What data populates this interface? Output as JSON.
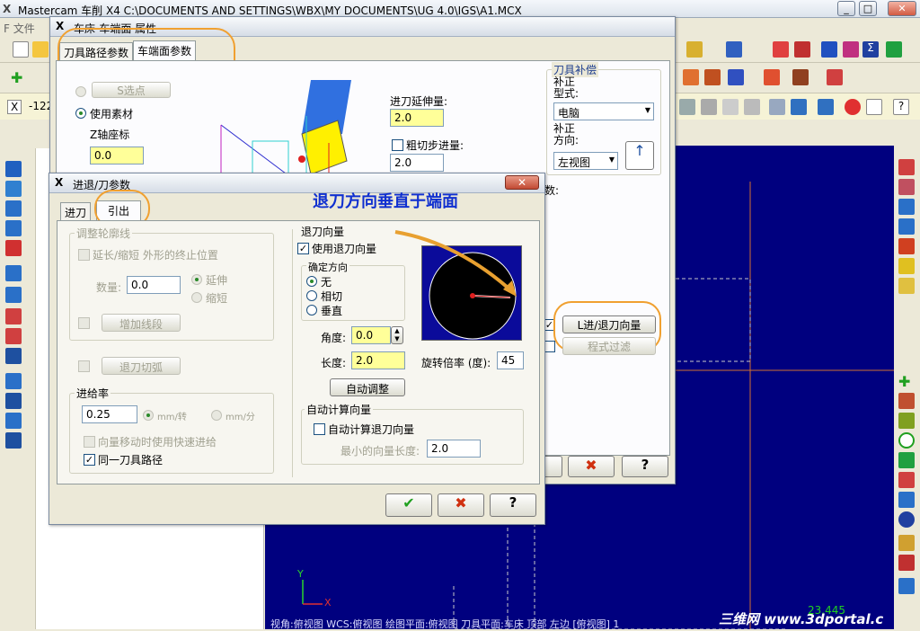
{
  "app": {
    "title": "Mastercam 车削  X4  C:\\DOCUMENTS AND SETTINGS\\WBX\\MY DOCUMENTS\\UG 4.0\\IGS\\A1.MCX",
    "menu_file": "F 文件",
    "coord_x_label": "X",
    "coord_x_value": "-122"
  },
  "props_dialog": {
    "title": "车床-车端面 属性",
    "tabs": [
      "刀具路径参数",
      "车端面参数"
    ],
    "select_point_label": "S选点",
    "use_stock_label": "使用素材",
    "z_coord_label": "Z轴座标",
    "z_coord_value": "0.0",
    "feed_ext_label": "进刀延伸量:",
    "feed_ext_value": "2.0",
    "rough_step_label": "粗切步进量:",
    "rough_step_value": "2.0",
    "tool_comp_group": "刀具补偿",
    "comp_type_label": "补正\n型式:",
    "comp_type_value": "电脑",
    "comp_dir_label": "补正\n方向:",
    "comp_dir_value": "左视图",
    "params_label": "数:",
    "lead_btn": "L进/退刀向量",
    "filter_btn": "程式过滤"
  },
  "lead_dialog": {
    "title": "进退/刀参数",
    "tabs": [
      "进刀",
      "引出"
    ],
    "adjust_group": "调整轮廓线",
    "extend_label": "延长/缩短 外形的终止位置",
    "amount_label": "数量:",
    "amount_value": "0.0",
    "extend_opt": "延伸",
    "shorten_opt": "缩短",
    "add_line_btn": "增加线段",
    "retract_arc_btn": "退刀切弧",
    "feed_group": "进给率",
    "feed_value": "0.25",
    "mm_rev": "mm/转",
    "mm_min": "mm/分",
    "rapid_label": "向量移动时使用快速进给",
    "same_path_label": "同一刀具路径",
    "retract_vec_group": "退刀向量",
    "use_retract_label": "使用退刀向量",
    "direction_group": "确定方向",
    "dir_none": "无",
    "dir_tangent": "相切",
    "dir_perp": "垂直",
    "angle_label": "角度:",
    "angle_value": "0.0",
    "length_label": "长度:",
    "length_value": "2.0",
    "rotate_label": "旋转倍率 (度):",
    "rotate_value": "45",
    "auto_adjust_btn": "自动调整",
    "auto_vec_group": "自动计算向量",
    "auto_calc_label": "自动计算退刀向量",
    "min_len_label": "最小的向量长度:",
    "min_len_value": "2.0"
  },
  "annotation": "退刀方向垂直于端面",
  "status": "视角:俯视图   WCS:俯视图   绘图平面:俯视图   刀具平面:车床 顶部 左边 [俯视图] 1",
  "watermark": "三维网 www.3dportal.c",
  "coord_readout": "23.445",
  "axis_y": "Y",
  "axis_x": "X",
  "colors": {
    "graphics_bg": "#00007f",
    "accent_orange": "#f0a030",
    "field_yellow": "#ffff99"
  }
}
